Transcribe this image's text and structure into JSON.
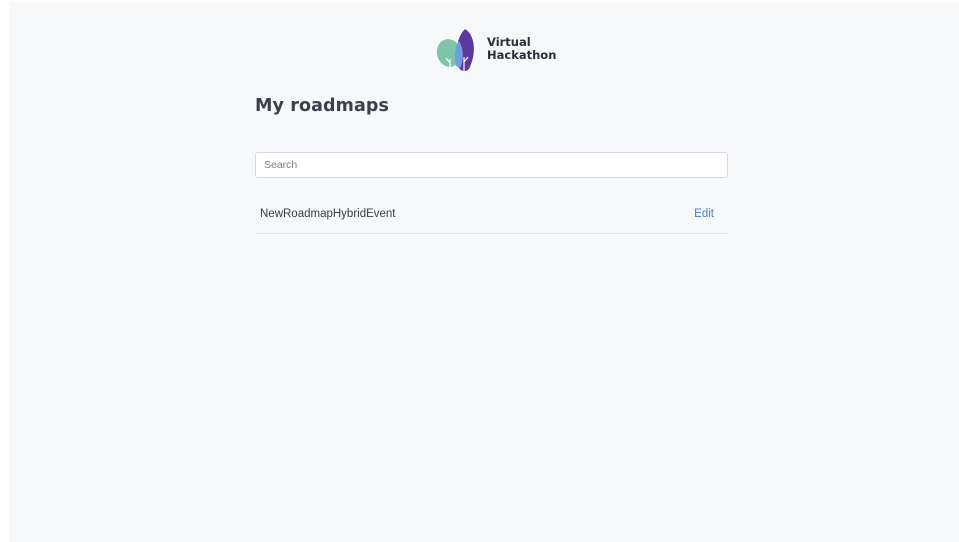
{
  "brand": {
    "line1": "Virtual",
    "line2": "Hackathon",
    "logo_icon": "tree-leaves-icon",
    "colors": {
      "green": "#7fc4a9",
      "blue": "#6d9fdc",
      "purple": "#5a3a9c"
    }
  },
  "page": {
    "title": "My roadmaps"
  },
  "search": {
    "placeholder": "Search",
    "value": ""
  },
  "roadmaps": [
    {
      "name": "NewRoadmapHybridEvent",
      "action_label": "Edit"
    }
  ],
  "colors": {
    "background": "#f7f8fa",
    "link": "#4a7fd4"
  }
}
